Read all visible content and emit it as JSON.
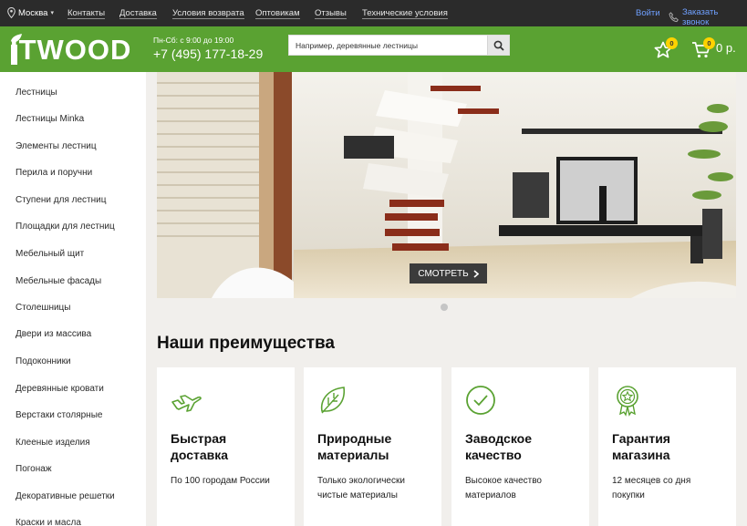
{
  "topbar": {
    "city": "Москва",
    "nav": [
      {
        "label": "Контакты"
      },
      {
        "label": "Доставка"
      },
      {
        "label": "Условия возврата"
      },
      {
        "label": "Оптовикам"
      },
      {
        "label": "Отзывы"
      },
      {
        "label": "Технические условия"
      }
    ],
    "login": "Войти",
    "callback": "Заказать звонок"
  },
  "header": {
    "logo_text": "ITWOOD",
    "hours": "Пн-Сб: с 9:00 до 19:00",
    "phone": "+7 (495) 177-18-29",
    "search_placeholder": "Например, деревянные лестницы",
    "favorites_count": "0",
    "cart_count": "0",
    "cart_total": "0 р."
  },
  "sidebar": {
    "items": [
      {
        "label": "Лестницы"
      },
      {
        "label": "Лестницы Minka"
      },
      {
        "label": "Элементы лестниц"
      },
      {
        "label": "Перила и поручни"
      },
      {
        "label": "Ступени для лестниц"
      },
      {
        "label": "Площадки для лестниц"
      },
      {
        "label": "Мебельный щит"
      },
      {
        "label": "Мебельные фасады"
      },
      {
        "label": "Столешницы"
      },
      {
        "label": "Двери из массива"
      },
      {
        "label": "Подоконники"
      },
      {
        "label": "Деревянные кровати"
      },
      {
        "label": "Верстаки столярные"
      },
      {
        "label": "Клееные изделия"
      },
      {
        "label": "Погонаж"
      },
      {
        "label": "Декоративные решетки"
      },
      {
        "label": "Краски и масла"
      }
    ]
  },
  "banner": {
    "button_label": "СМОТРЕТЬ"
  },
  "advantages": {
    "title": "Наши преимущества",
    "cards": [
      {
        "icon": "airplane-icon",
        "title": "Быстрая\nдоставка",
        "desc": "По 100 городам России"
      },
      {
        "icon": "leaf-icon",
        "title": "Природные\nматериалы",
        "desc": "Только экологически\nчистые материалы"
      },
      {
        "icon": "check-circle-icon",
        "title": "Заводское\nкачество",
        "desc": "Высокое качество\nматериалов"
      },
      {
        "icon": "award-icon",
        "title": "Гарантия\nмагазина",
        "desc": "12 месяцев со дня\nпокупки"
      }
    ]
  },
  "colors": {
    "brand_green": "#5aa232",
    "topbar": "#2b2b2b",
    "link_blue": "#6fa0ff",
    "badge": "#ffd200"
  }
}
